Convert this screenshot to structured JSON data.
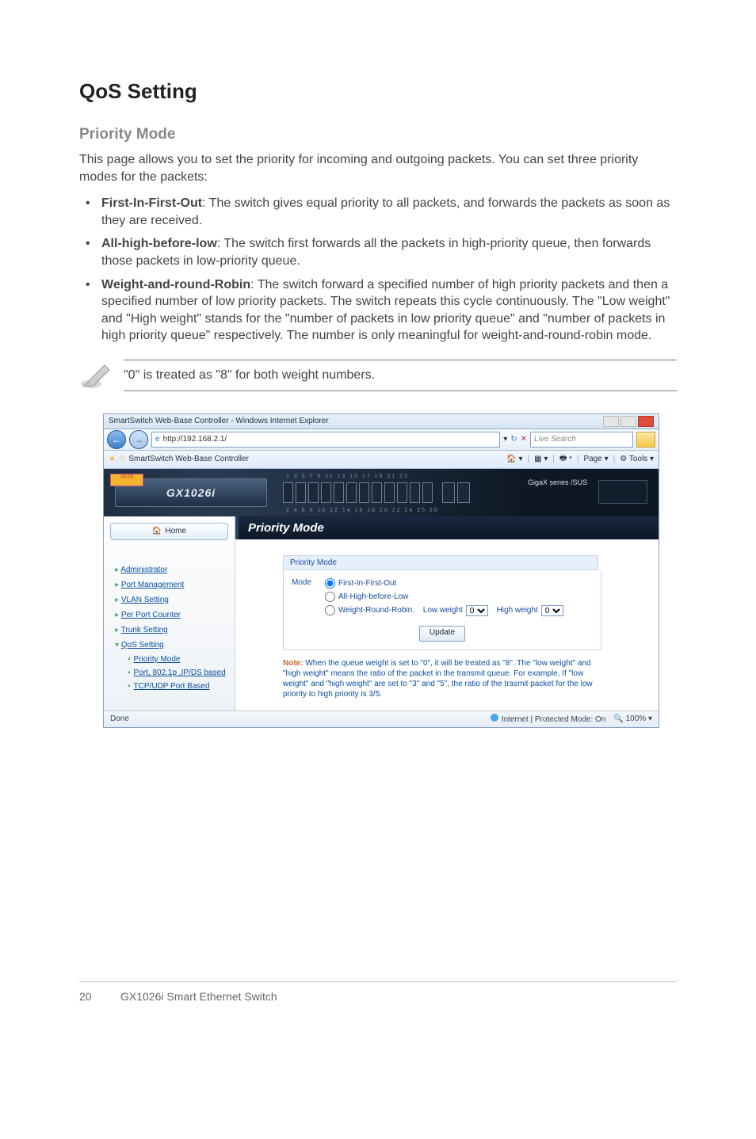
{
  "heading": "QoS Setting",
  "subheading": "Priority Mode",
  "intro": "This page allows you to set the priority for incoming and outgoing packets. You can set three priority modes for the packets:",
  "bullets": [
    {
      "term": "First-In-First-Out",
      "desc": ": The switch gives equal priority to all packets, and forwards the packets as soon as they are received."
    },
    {
      "term": "All-high-before-low",
      "desc": ": The switch first forwards all the packets in high-priority queue, then forwards those packets in low-priority queue."
    },
    {
      "term": "Weight-and-round-Robin",
      "desc": ": The switch forward a specified number of high priority packets and then a specified number of low priority packets. The switch repeats this cycle continuously. The \"Low weight\" and \"High weight\" stands for the \"number of packets in low priority queue\" and \"number of packets in high priority queue\" respectively. The number is only meaningful for weight-and-round-robin mode."
    }
  ],
  "note": "\"0\" is treated as \"8\" for both weight numbers.",
  "screenshot": {
    "window_title": "SmartSwitch Web-Base Controller - Windows Internet Explorer",
    "url": "http://192.168.2.1/",
    "search_placeholder": "Live Search",
    "tab_title": "SmartSwitch Web-Base Controller",
    "toolbar_items": {
      "page": "Page",
      "tools": "Tools"
    },
    "brand": "GX1026i",
    "asus": "GigaX series /SUS",
    "sidebar": {
      "home": "Home",
      "items": [
        "Administrator",
        "Port Management",
        "VLAN Setting",
        "Per Port Counter",
        "Trunk Setting",
        "QoS Setting"
      ],
      "qos_sub": [
        "Priority Mode",
        "Port, 802.1p ,IP/DS based",
        "TCP/UDP Port Based"
      ]
    },
    "panel": {
      "header": "Priority Mode",
      "box_title": "Priority Mode",
      "mode_label": "Mode",
      "opt1": "First-In-First-Out",
      "opt2": "All-High-before-Low",
      "opt3": "Weight-Round-Robin.",
      "low_label": "Low weight",
      "high_label": "High weight",
      "low_val": "0",
      "high_val": "0",
      "update": "Update",
      "note_label": "Note:",
      "note_body": " When the queue weight is set to \"0\", it will be treated as \"8\". The \"low weight\" and \"high weight\" means the ratio of the packet in the transmit queue. For example, If \"low weight\" and \"high weight\" are set to \"3\" and \"5\", the ratio of the trasmit packet for the low priority to high priority is 3/5."
    },
    "status": {
      "done": "Done",
      "zone": "Internet | Protected Mode: On",
      "zoom": "100%"
    }
  },
  "footer": {
    "page": "20",
    "product": "GX1026i Smart Ethernet Switch"
  }
}
